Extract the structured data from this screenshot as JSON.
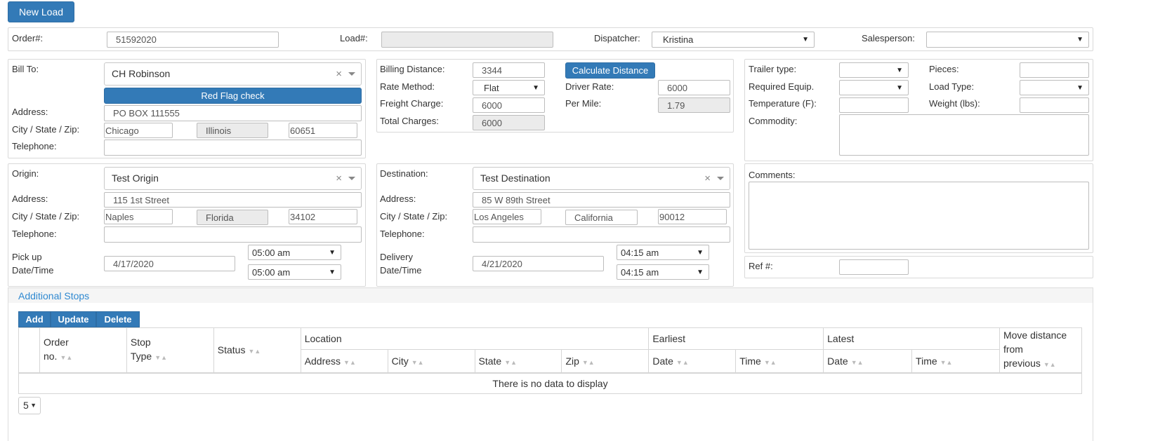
{
  "header": {
    "new_load_label": "New Load"
  },
  "order": {
    "order_label": "Order#:",
    "order_value": "51592020",
    "load_label": "Load#:",
    "load_value": "",
    "dispatcher_label": "Dispatcher:",
    "dispatcher_value": "Kristina",
    "salesperson_label": "Salesperson:",
    "salesperson_value": ""
  },
  "bill_to": {
    "label": "Bill To:",
    "value": "CH Robinson",
    "clear": "×",
    "red_flag_label": "Red Flag check",
    "address_label": "Address:",
    "address": "PO BOX 111555",
    "csz_label": "City / State / Zip:",
    "city": "Chicago",
    "state": "Illinois",
    "zip": "60651",
    "telephone_label": "Telephone:",
    "telephone": ""
  },
  "billing": {
    "distance_label": "Billing Distance:",
    "distance": "3344",
    "calc_label": "Calculate Distance",
    "rate_method_label": "Rate Method:",
    "rate_method": "Flat",
    "driver_rate_label": "Driver Rate:",
    "driver_rate": "6000",
    "freight_label": "Freight Charge:",
    "freight": "6000",
    "per_mile_label": "Per Mile:",
    "per_mile": "1.79",
    "total_label": "Total Charges:",
    "total": "6000"
  },
  "trailer": {
    "type_label": "Trailer type:",
    "type": "",
    "pieces_label": "Pieces:",
    "pieces": "",
    "equip_label": "Required Equip.",
    "equip": "",
    "load_type_label": "Load Type:",
    "load_type": "",
    "temp_label": "Temperature (F):",
    "temp": "",
    "weight_label": "Weight (lbs):",
    "weight": "",
    "commodity_label": "Commodity:"
  },
  "origin": {
    "label": "Origin:",
    "value": "Test Origin",
    "clear": "×",
    "address_label": "Address:",
    "address": "115 1st Street",
    "csz_label": "City / State / Zip:",
    "city": "Naples",
    "state": "Florida",
    "zip": "34102",
    "telephone_label": "Telephone:",
    "telephone": "",
    "date_label_1": "Pick up",
    "date_label_2": "Date/Time",
    "date": "4/17/2020",
    "time_from": "05:00 am",
    "time_to": "05:00 am"
  },
  "destination": {
    "label": "Destination:",
    "value": "Test Destination",
    "clear": "×",
    "address_label": "Address:",
    "address": "85 W 89th Street",
    "csz_label": "City / State / Zip:",
    "city": "Los Angeles",
    "state": "California",
    "zip": "90012",
    "telephone_label": "Telephone:",
    "telephone": "",
    "date_label_1": "Delivery",
    "date_label_2": "Date/Time",
    "date": "4/21/2020",
    "time_from": "04:15 am",
    "time_to": "04:15 am"
  },
  "comments": {
    "label": "Comments:",
    "ref_label": "Ref #:",
    "ref": ""
  },
  "stops": {
    "title": "Additional Stops",
    "add_label": "Add",
    "update_label": "Update",
    "delete_label": "Delete",
    "columns": {
      "order_no_1": "Order",
      "order_no_2": "no.",
      "stop_type_1": "Stop",
      "stop_type_2": "Type",
      "status": "Status",
      "location": "Location",
      "address": "Address",
      "city": "City",
      "state": "State",
      "zip": "Zip",
      "earliest": "Earliest",
      "latest": "Latest",
      "date": "Date",
      "time": "Time",
      "move_1": "Move distance",
      "move_2": "from previous"
    },
    "empty_text": "There is no data to display",
    "page_size": "5"
  }
}
